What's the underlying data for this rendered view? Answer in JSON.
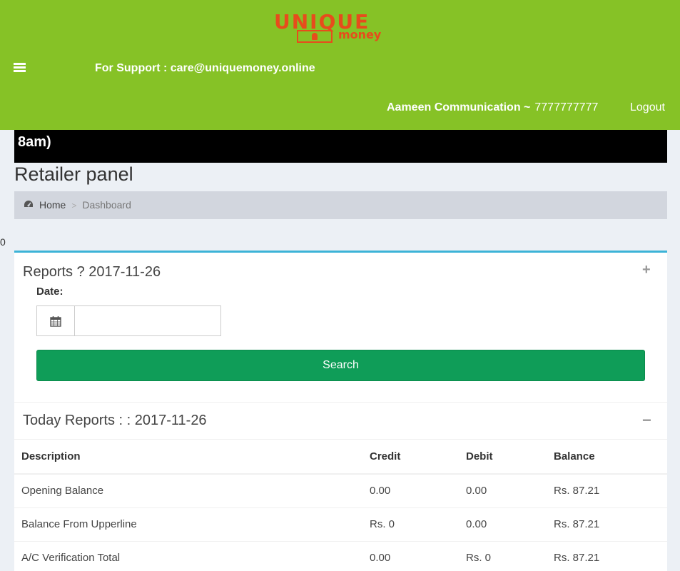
{
  "header": {
    "logo_top": "UNIQUE",
    "logo_sub": "money",
    "support_text": "For Support : care@uniquemoney.online",
    "user_name": "Aameen Communication ~",
    "user_phone": "7777777777",
    "logout_label": "Logout",
    "menu_icon": "hamburger-icon",
    "bg_color": "#86c226"
  },
  "ticker": {
    "text": "8am)"
  },
  "page": {
    "title": "Retailer panel"
  },
  "breadcrumb": {
    "home_icon": "dashboard-icon",
    "home": "Home",
    "separator": ">",
    "current": "Dashboard"
  },
  "stray_text": "0",
  "reports": {
    "title": "Reports ? 2017-11-26",
    "collapse_icon": "plus-icon",
    "date_label": "Date:",
    "date_icon": "calendar-icon",
    "date_value": "",
    "search_label": "Search",
    "search_color": "#0f9d58"
  },
  "today": {
    "title": "Today Reports : : 2017-11-26",
    "collapse_icon": "minus-icon",
    "columns": [
      "Description",
      "Credit",
      "Debit",
      "Balance"
    ],
    "rows": [
      [
        "Opening Balance",
        "0.00",
        "0.00",
        "Rs. 87.21"
      ],
      [
        "Balance From Upperline",
        "Rs. 0",
        "0.00",
        "Rs. 87.21"
      ],
      [
        "A/C Verification Total",
        "0.00",
        "Rs. 0",
        "Rs. 87.21"
      ]
    ]
  }
}
